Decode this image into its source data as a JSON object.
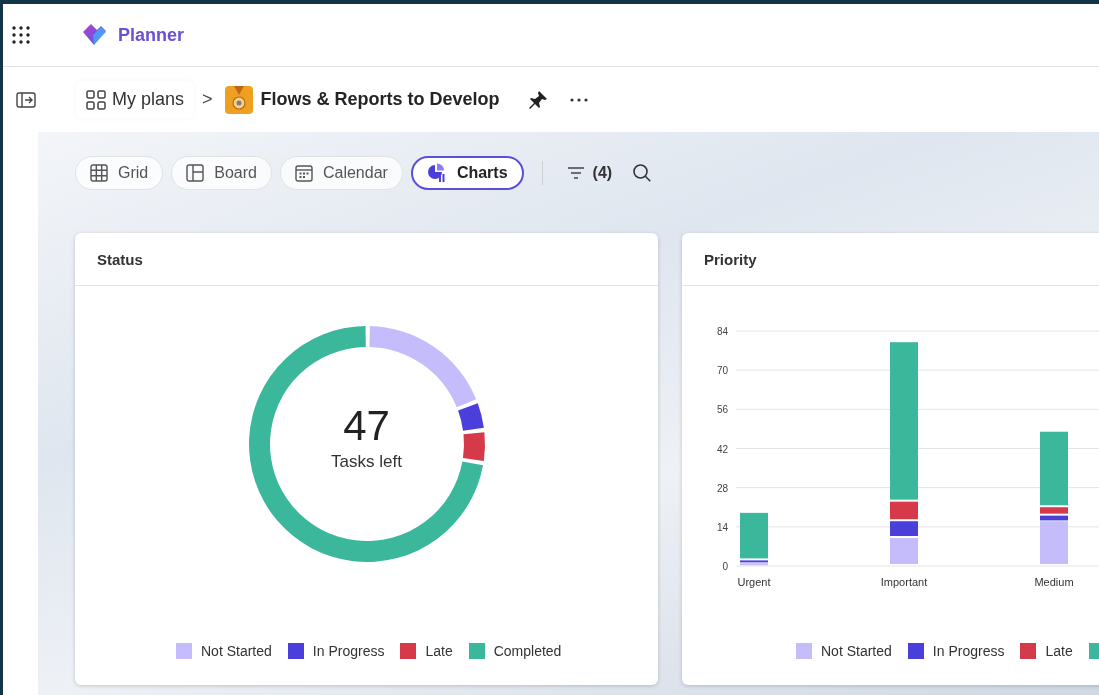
{
  "app": {
    "title": "Planner"
  },
  "breadcrumb": {
    "root": "My plans",
    "separator": ">",
    "plan": "Flows & Reports to Develop"
  },
  "views": [
    {
      "label": "Grid",
      "kind": "grid",
      "selected": false
    },
    {
      "label": "Board",
      "kind": "board",
      "selected": false
    },
    {
      "label": "Calendar",
      "kind": "calendar",
      "selected": false
    },
    {
      "label": "Charts",
      "kind": "charts",
      "selected": true
    }
  ],
  "filter": {
    "count": "(4)"
  },
  "status": {
    "title": "Status",
    "center_value": "47",
    "center_label": "Tasks left",
    "legend": [
      {
        "label": "Not Started",
        "color": "#c5bdfb"
      },
      {
        "label": "In Progress",
        "color": "#4b3fdb"
      },
      {
        "label": "Late",
        "color": "#d63a4a"
      },
      {
        "label": "Completed",
        "color": "#3bb89b"
      }
    ]
  },
  "priority": {
    "title": "Priority",
    "chart_data": {
      "type": "bar",
      "stacked": true,
      "grid": true,
      "categories": [
        "Urgent",
        "Important",
        "Medium"
      ],
      "ylim": [
        0,
        84
      ],
      "yticks": [
        0,
        14,
        28,
        42,
        56,
        70,
        84
      ],
      "series": [
        {
          "name": "Not Started",
          "color": "#c5bdfb",
          "values": [
            1,
            10,
            16
          ]
        },
        {
          "name": "In Progress",
          "color": "#4b3fdb",
          "values": [
            1,
            6,
            2
          ]
        },
        {
          "name": "Late",
          "color": "#d63a4a",
          "values": [
            0,
            7,
            3
          ]
        },
        {
          "color": "#3bb89b",
          "values": [
            17,
            57,
            27
          ]
        }
      ]
    }
  }
}
